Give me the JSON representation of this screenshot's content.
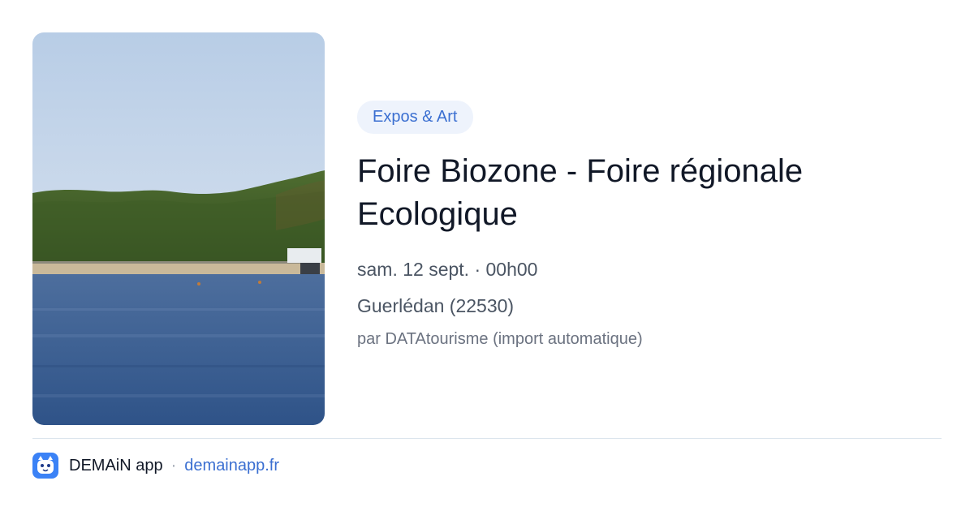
{
  "event": {
    "category": "Expos & Art",
    "title": "Foire Biozone - Foire régionale Ecologique",
    "date": "sam. 12 sept. · 00h00",
    "location": "Guerlédan (22530)",
    "source": "par DATAtourisme (import automatique)",
    "image": "lake-landscape-photo"
  },
  "footer": {
    "app_name": "DEMAiN app",
    "separator": "·",
    "domain": "demainapp.fr",
    "icon": "demain-app-icon"
  },
  "colors": {
    "accent": "#3b6fd1",
    "badge_bg": "#eef3fc",
    "title": "#111827",
    "meta": "#4b5563",
    "muted": "#6b7280"
  }
}
